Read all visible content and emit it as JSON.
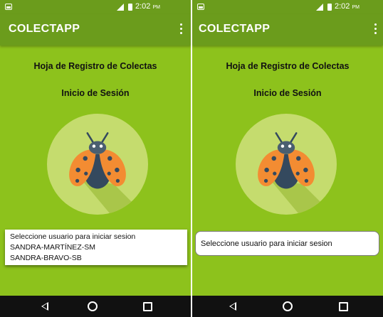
{
  "screens": [
    {
      "status": {
        "time": "2:02",
        "ampm": "PM"
      },
      "app_title": "COLECTAPP",
      "heading": "Hoja de Registro de Colectas",
      "subheading": "Inicio de Sesión",
      "user_list": {
        "prompt": "Seleccione usuario para iniciar sesion",
        "options": [
          "SANDRA-MARTÍNEZ-SM",
          "SANDRA-BRAVO-SB"
        ]
      }
    },
    {
      "status": {
        "time": "2:02",
        "ampm": "PM"
      },
      "app_title": "COLECTAPP",
      "heading": "Hoja de Registro de Colectas",
      "subheading": "Inicio de Sesión",
      "user_select": {
        "value": "Seleccione usuario para iniciar sesion"
      }
    }
  ],
  "icons": {
    "overflow_menu": "more-vert-icon",
    "logo": "ladybug-icon",
    "nav_back": "back-triangle-icon",
    "nav_home": "home-circle-icon",
    "nav_recent": "recent-square-icon"
  },
  "colors": {
    "background": "#8dc21c",
    "toolbar": "#6b9c1c",
    "logo_circle": "#c5dc6e",
    "logo_shadow": "#a9c64a",
    "ladybug_wings": "#f38c32",
    "ladybug_body": "#34495e",
    "navbar": "#111111"
  }
}
